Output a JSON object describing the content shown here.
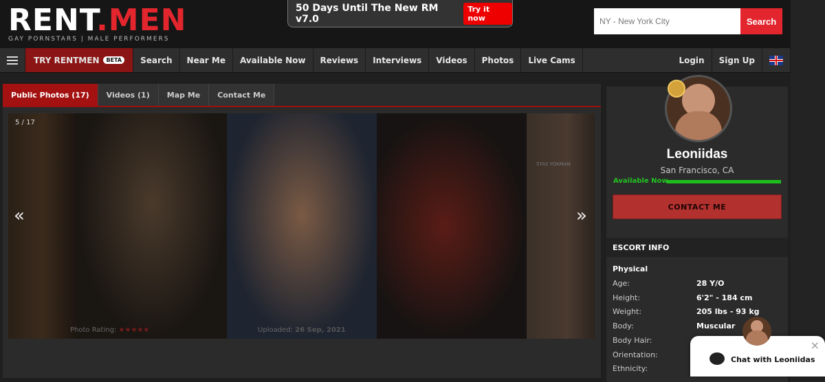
{
  "header": {
    "logo_main_1": "RENT",
    "logo_main_2": ".MEN",
    "logo_sub": "GAY PORNSTARS | MALE PERFORMERS",
    "promo_text": "50 Days Until The New RM v7.0",
    "promo_button": "Try it now",
    "search_placeholder": "NY - New York City",
    "search_button": "Search"
  },
  "nav": {
    "try_label": "TRY RENTMEN",
    "beta": "BETA",
    "items": [
      "Search",
      "Near Me",
      "Available Now",
      "Reviews",
      "Interviews",
      "Videos",
      "Photos",
      "Live Cams"
    ],
    "login": "Login",
    "signup": "Sign Up"
  },
  "tabs": [
    "Public Photos (17)",
    "Videos (1)",
    "Map Me",
    "Contact Me"
  ],
  "gallery": {
    "counter": "5 / 17",
    "prev": "«",
    "next": "»",
    "rating_label": "Photo Rating:",
    "rating_stars": "★★★★★",
    "uploaded_label": "Uploaded:",
    "uploaded_date": "26 Sep, 2021",
    "watermark": "STAS YOKMAN"
  },
  "profile": {
    "name": "Leoniidas",
    "location": "San Francisco, CA",
    "availability": "Available Now",
    "contact_button": "CONTACT ME",
    "info_header": "ESCORT INFO",
    "section": "Physical",
    "rows": [
      {
        "k": "Age:",
        "v": "28 Y/O"
      },
      {
        "k": "Height:",
        "v": "6'2\" - 184 cm"
      },
      {
        "k": "Weight:",
        "v": "205 lbs - 93 kg"
      },
      {
        "k": "Body:",
        "v": "Muscular"
      },
      {
        "k": "Body Hair:",
        "v": ""
      },
      {
        "k": "Orientation:",
        "v": ""
      },
      {
        "k": "Ethnicity:",
        "v": ""
      }
    ]
  },
  "chat": {
    "label": "Chat with Leoniidas",
    "close": "×"
  },
  "colors": {
    "brand_red": "#e3262e",
    "available_green": "#22c322"
  }
}
